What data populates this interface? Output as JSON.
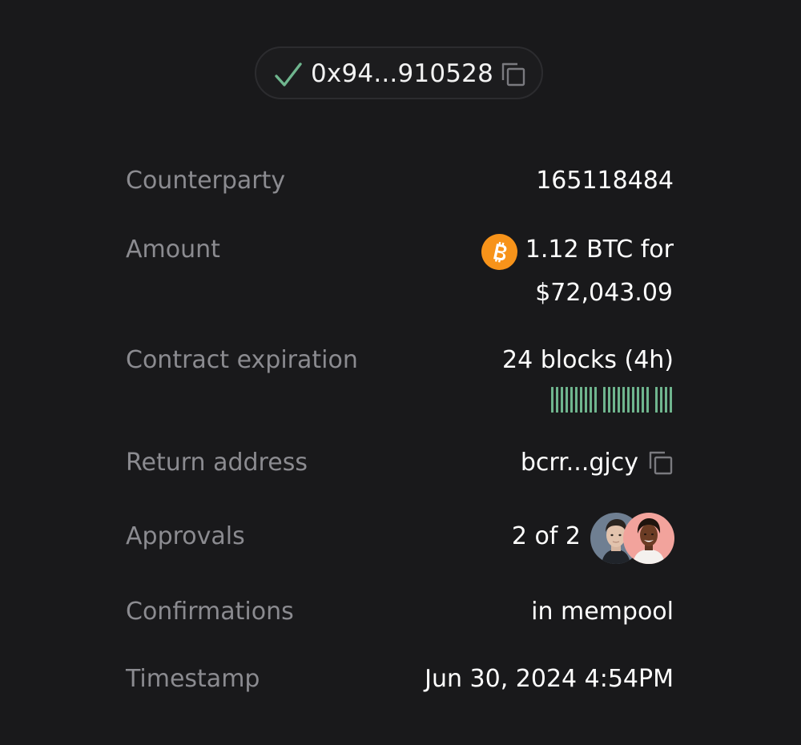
{
  "transaction": {
    "hash": "0x94...910528",
    "status_icon": "check-icon",
    "copy_icon": "copy-icon",
    "status_color": "#6fb58e"
  },
  "details": {
    "counterparty": {
      "label": "Counterparty",
      "value": "165118484"
    },
    "amount": {
      "label": "Amount",
      "line1": "1.12 BTC for",
      "line2": "$72,043.09",
      "currency_icon": "bitcoin-icon",
      "currency_color": "#f7931a"
    },
    "contract_expiration": {
      "label": "Contract expiration",
      "value": "24 blocks (4h)",
      "blocks_total": 24,
      "blocks_remaining": 24,
      "bar_color": "#6fb58e"
    },
    "return_address": {
      "label": "Return address",
      "value": "bcrr...gjcy",
      "copy_icon": "copy-icon"
    },
    "approvals": {
      "label": "Approvals",
      "value": "2 of 2",
      "approvers": [
        "approver-avatar-1",
        "approver-avatar-2"
      ]
    },
    "confirmations": {
      "label": "Confirmations",
      "value": "in mempool"
    },
    "timestamp": {
      "label": "Timestamp",
      "value": "Jun 30, 2024 4:54PM"
    }
  },
  "colors": {
    "background": "#19191b",
    "label": "#8b8b90",
    "value": "#ffffff",
    "accent_green": "#6fb58e",
    "bitcoin": "#f7931a"
  }
}
